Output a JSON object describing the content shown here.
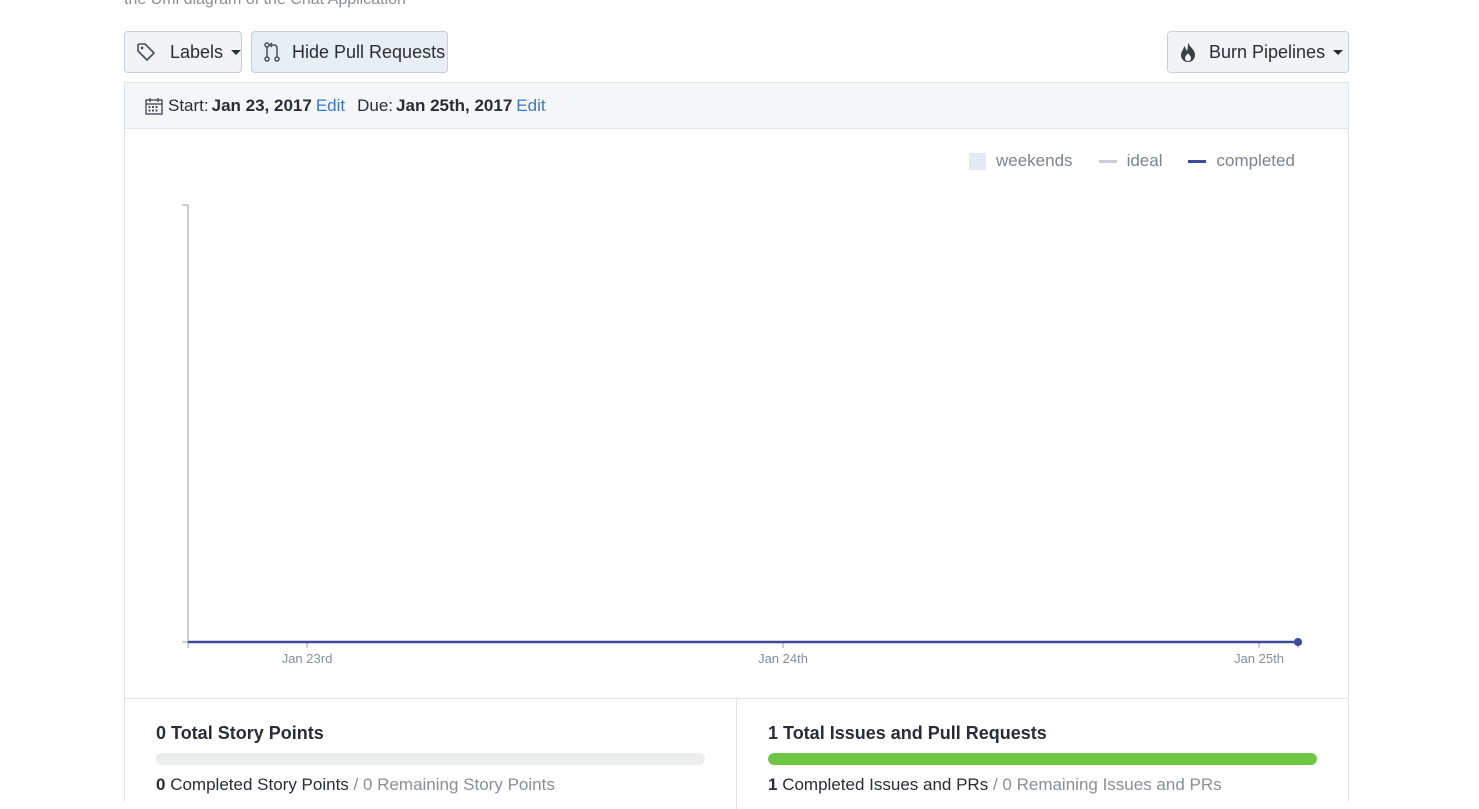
{
  "header": {
    "description": "the Uml diagram of the Chat Application"
  },
  "toolbar": {
    "labels_label": "Labels",
    "hide_prs_label": "Hide Pull Requests",
    "burn_pipelines_label": "Burn Pipelines"
  },
  "dates": {
    "start_label": "Start:",
    "start_value": "Jan 23, 2017",
    "due_label": "Due:",
    "due_value": "Jan 25th, 2017",
    "edit_label": "Edit"
  },
  "legend": {
    "weekends": "weekends",
    "ideal": "ideal",
    "completed": "completed"
  },
  "colors": {
    "completed": "#3d4a9a",
    "ideal": "#c9ccd2",
    "weekends": "#e6e9f4",
    "progress": "#6cc644",
    "link": "#3a78c3"
  },
  "chart_data": {
    "type": "line",
    "x": [
      "Jan 23rd",
      "Jan 24th",
      "Jan 25th"
    ],
    "series": [
      {
        "name": "completed",
        "values": [
          0,
          0,
          0
        ]
      }
    ],
    "legend": [
      "weekends",
      "ideal",
      "completed"
    ],
    "legend_position": "top-right",
    "grid": false
  },
  "stats": {
    "story_points": {
      "total_value": "0",
      "total_label": "Total Story Points",
      "progress": 0,
      "completed_value": "0",
      "completed_label": "Completed Story Points",
      "separator": "/",
      "remaining_label": "0 Remaining Story Points"
    },
    "issues": {
      "total_value": "1",
      "total_label": "Total Issues and Pull Requests",
      "progress": 1,
      "completed_value": "1",
      "completed_label": "Completed Issues and PRs",
      "separator": "/",
      "remaining_label": "0 Remaining Issues and PRs"
    }
  }
}
